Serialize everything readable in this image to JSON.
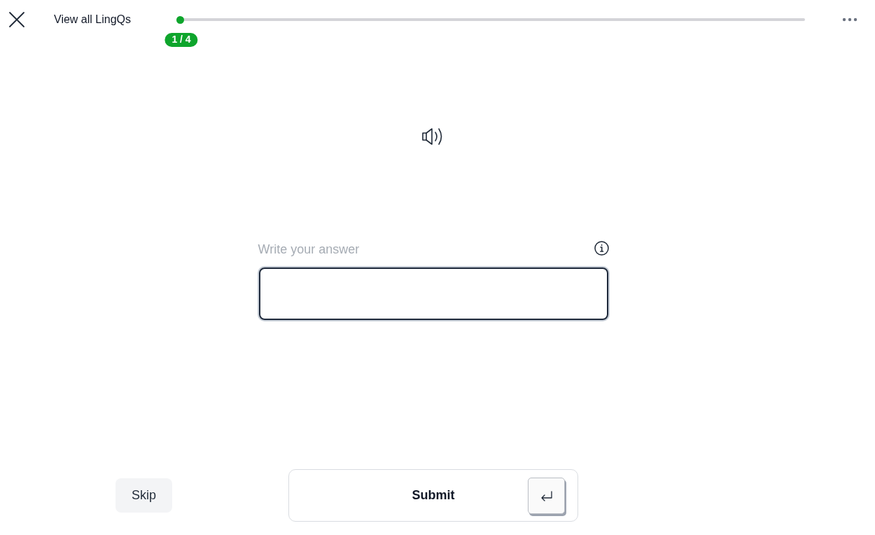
{
  "header": {
    "link": "View all LingQs",
    "progress": {
      "level": 0,
      "counter": "1 / 4"
    }
  },
  "answer": {
    "label": "Write your answer"
  },
  "footer": {
    "skip": "Skip",
    "submit": "Submit"
  }
}
